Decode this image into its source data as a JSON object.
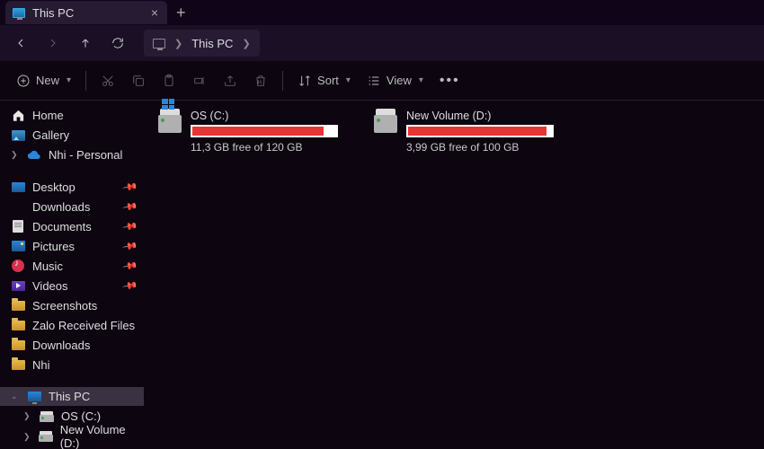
{
  "tab": {
    "title": "This PC"
  },
  "address": {
    "location": "This PC"
  },
  "toolbar": {
    "new": "New",
    "sort": "Sort",
    "view": "View"
  },
  "sidebar": {
    "home": "Home",
    "gallery": "Gallery",
    "cloud": "Nhi - Personal",
    "quick": [
      {
        "label": "Desktop",
        "icon": "desktop",
        "pinned": true
      },
      {
        "label": "Downloads",
        "icon": "download",
        "pinned": true
      },
      {
        "label": "Documents",
        "icon": "document",
        "pinned": true
      },
      {
        "label": "Pictures",
        "icon": "picture",
        "pinned": true
      },
      {
        "label": "Music",
        "icon": "music",
        "pinned": true
      },
      {
        "label": "Videos",
        "icon": "video",
        "pinned": true
      },
      {
        "label": "Screenshots",
        "icon": "folder",
        "pinned": false
      },
      {
        "label": "Zalo Received Files",
        "icon": "folder",
        "pinned": false
      },
      {
        "label": "Downloads",
        "icon": "folder",
        "pinned": false
      },
      {
        "label": "Nhi",
        "icon": "folder",
        "pinned": false
      }
    ],
    "thispc": {
      "label": "This PC",
      "children": [
        {
          "label": "OS (C:)"
        },
        {
          "label": "New Volume (D:)"
        }
      ]
    }
  },
  "drives": [
    {
      "name": "OS (C:)",
      "free_text": "11,3 GB free of 120 GB",
      "used_pct": 91,
      "os": true
    },
    {
      "name": "New Volume (D:)",
      "free_text": "3,99 GB free of 100 GB",
      "used_pct": 96,
      "os": false
    }
  ]
}
